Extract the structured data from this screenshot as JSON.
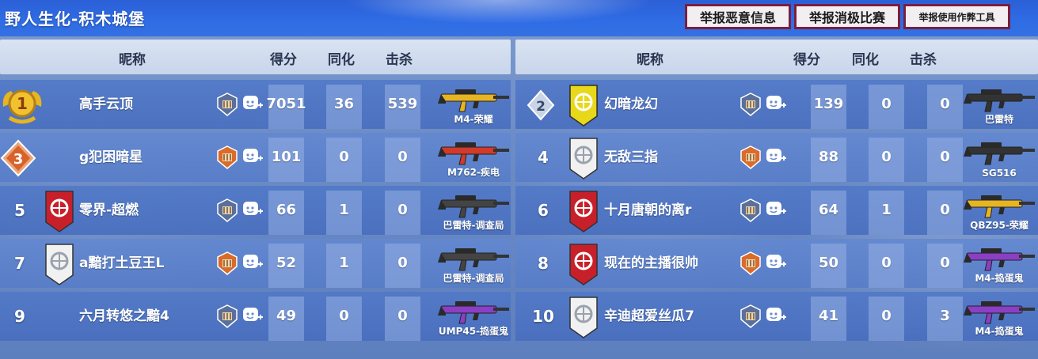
{
  "title": "野人生化-积木城堡",
  "report_buttons": [
    "举报恶意信息",
    "举报消极比赛",
    "举报使用作弊工具"
  ],
  "columns": {
    "nickname": "昵称",
    "score": "得分",
    "infect": "同化",
    "kills": "击杀"
  },
  "left_team": [
    {
      "rank": "1",
      "name": "高手云顶",
      "score": "7051",
      "infect": "36",
      "kills": "539",
      "weapon": "M4-荣耀",
      "weapon_color": "#e7b422",
      "avatar": "gold-medal-rank-1"
    },
    {
      "rank": "3",
      "name": "g犯困暗星",
      "score": "101",
      "infect": "0",
      "kills": "0",
      "weapon": "M762-疾电",
      "weapon_color": "#d23a2a",
      "avatar": "bronze-diamond-rank-3"
    },
    {
      "rank": "5",
      "name": "零界-超燃",
      "score": "66",
      "infect": "1",
      "kills": "0",
      "weapon": "巴雷特-调查局",
      "weapon_color": "#444444",
      "avatar": "red-shield-avatar"
    },
    {
      "rank": "7",
      "name": "a黯打土豆王L",
      "score": "52",
      "infect": "1",
      "kills": "0",
      "weapon": "巴雷特-调查局",
      "weapon_color": "#444444",
      "avatar": "white-shield-avatar"
    },
    {
      "rank": "9",
      "name": "六月转悠之黯4",
      "score": "49",
      "infect": "0",
      "kills": "0",
      "weapon": "UMP45-捣蛋鬼",
      "weapon_color": "#8a3fc4",
      "avatar": "none"
    }
  ],
  "right_team": [
    {
      "rank": "2",
      "name": "幻暗龙幻",
      "score": "139",
      "infect": "0",
      "kills": "0",
      "weapon": "巴雷特",
      "weapon_color": "#333333",
      "avatar": "yellow-shield-avatar"
    },
    {
      "rank": "4",
      "name": "无敌三指",
      "score": "88",
      "infect": "0",
      "kills": "0",
      "weapon": "SG516",
      "weapon_color": "#333333",
      "avatar": "white-shield-avatar"
    },
    {
      "rank": "6",
      "name": "十月唐朝的离r",
      "score": "64",
      "infect": "1",
      "kills": "0",
      "weapon": "QBZ95-荣耀",
      "weapon_color": "#e7b422",
      "avatar": "red-shield-avatar"
    },
    {
      "rank": "8",
      "name": "现在的主播很帅",
      "score": "50",
      "infect": "0",
      "kills": "0",
      "weapon": "M4-捣蛋鬼",
      "weapon_color": "#8a3fc4",
      "avatar": "red-shield-avatar"
    },
    {
      "rank": "10",
      "name": "辛迪超爱丝瓜7",
      "score": "41",
      "infect": "0",
      "kills": "3",
      "weapon": "M4-捣蛋鬼",
      "weapon_color": "#8a3fc4",
      "avatar": "white-shield-avatar"
    }
  ],
  "colors": {
    "topbar": "#2f6de6",
    "report_border": "#7a1f3d",
    "gold": "#e7b422"
  }
}
